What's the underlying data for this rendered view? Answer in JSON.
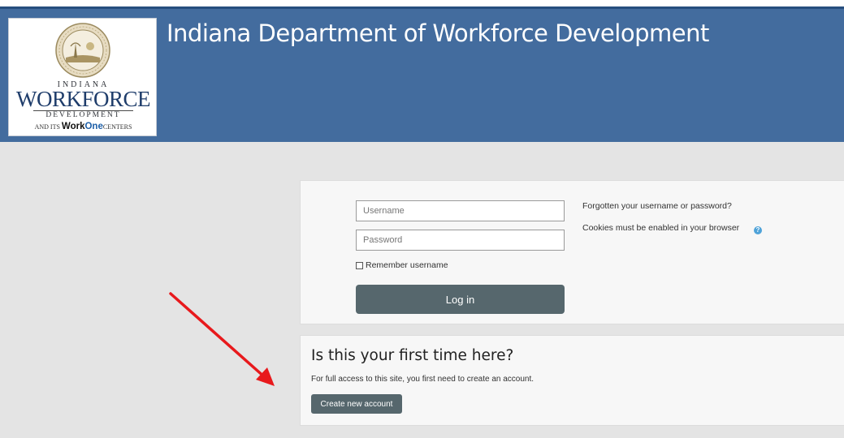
{
  "header": {
    "title": "Indiana Department of Workforce Development",
    "logo": {
      "line_indiana": "INDIANA",
      "line_workforce": "WORKFORCE",
      "line_development": "DEVELOPMENT",
      "line_centers_prefix": "AND ITS",
      "line_centers_work": "Work",
      "line_centers_one": "One",
      "line_centers_suffix": "CENTERS"
    }
  },
  "login": {
    "username_placeholder": "Username",
    "password_placeholder": "Password",
    "remember_label": "Remember username",
    "login_button": "Log in",
    "forgot_link": "Forgotten your username or password?",
    "cookies_note": "Cookies must be enabled in your browser",
    "help_icon": "question-circle"
  },
  "first_time": {
    "heading": "Is this your first time here?",
    "text": "For full access to this site, you first need to create an account.",
    "button": "Create new account"
  },
  "colors": {
    "banner": "#436c9e",
    "button": "#56676d",
    "arrow": "#e8191c",
    "help_icon": "#4fa3d9"
  }
}
